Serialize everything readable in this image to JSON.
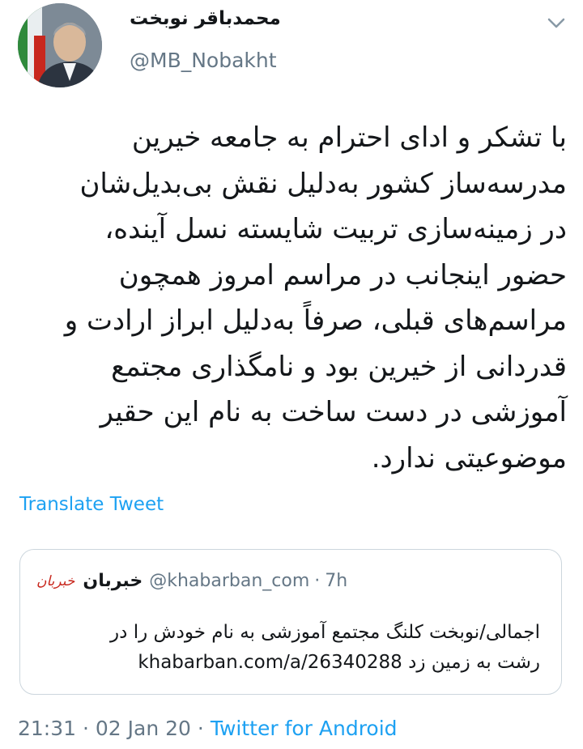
{
  "author": {
    "display_name": "محمدباقر نوبخت",
    "handle": "@MB_Nobakht"
  },
  "icons": {
    "chevron": "chevron-down-icon"
  },
  "tweet": {
    "lines": [
      "با تشکر و ادای احترام به جامعه خیرین",
      "مدرسه‌ساز کشور به‌دلیل نقش بی‌بدیل‌شان",
      "در زمینه‌سازی تربیت شایسته نسل آینده،",
      "حضور اینجانب در مراسم امروز همچون",
      "مراسم‌های قبلی، صرفاً به‌دلیل ابراز ارادت و",
      "قدردانی از خیرین بود و نامگذاری مجتمع",
      "آموزشی در دست ساخت به نام این حقیر",
      "موضوعیتی ندارد."
    ],
    "translate_label": "Translate Tweet"
  },
  "quote": {
    "avatar_text": "خبربان",
    "name": "خبربان",
    "handle": "@khabarban_com",
    "separator": "·",
    "time": "7h",
    "lines": [
      "اجمالی/نوبخت کلنگ مجتمع آموزشی به نام خودش را در",
      "رشت به زمین زد khabarban.com/a/26340288"
    ]
  },
  "meta": {
    "time": "21:31",
    "separator": "·",
    "date": "02 Jan 20",
    "separator2": "·",
    "source": "Twitter for Android"
  }
}
